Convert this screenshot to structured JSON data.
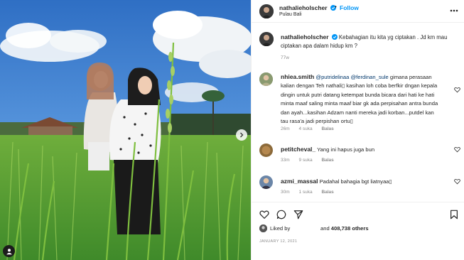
{
  "post": {
    "username": "nathalieholscher",
    "follow_label": "Follow",
    "separator": "•",
    "location": "Pulau Bali",
    "caption_text": "Kebahagian itu kita yg ciptakan . Jd km mau ciptakan apa dalam hidup km ?",
    "caption_time": "77w"
  },
  "comments": [
    {
      "username": "nhiea.smith",
      "mention1": "@putridelinaa",
      "mention2": "@ferdinan_sule",
      "text": "gimana perasaan kalian dengan Teh nathali▯ kasihan loh coba berfkir dngan kepala dingin untuk putri datang ketempat bunda bicara dari hati ke hati minta maaf saling minta maaf biar gk ada perpisahan antra bunda dan ayah...kasihan Adzam nanti mereka jadi korban...putdel kan tau rasa'a jadi perpishan ortu▯",
      "time": "26m",
      "likes": "4 suka",
      "reply": "Balas"
    },
    {
      "username": "petitcheval_",
      "text": "Yang ini hapus juga bun",
      "time": "33m",
      "likes": "9 suka",
      "reply": "Balas"
    },
    {
      "username": "azmi_massal",
      "text": "Padahal bahagia bgt liatnyaa▯",
      "time": "30m",
      "likes": "1 suka",
      "reply": "Balas"
    }
  ],
  "likes": {
    "prefix": "Liked by",
    "and_label": "and",
    "count": "408,738 others"
  },
  "date": "JANUARY 12, 2021",
  "colors": {
    "accent": "#0095f6",
    "verified": "#0095f6",
    "muted": "#8e8e8e",
    "mention": "#00376b"
  },
  "icons": [
    "verified-icon",
    "more-options-icon",
    "heart-icon",
    "comment-icon",
    "share-icon",
    "bookmark-icon",
    "carousel-next-icon",
    "tagged-user-icon"
  ]
}
